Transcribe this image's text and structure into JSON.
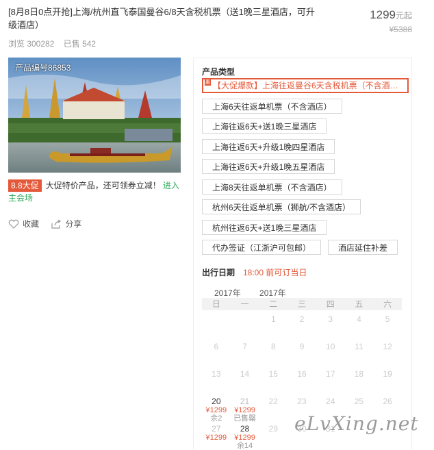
{
  "product": {
    "title": "[8月8日0点开抢]上海/杭州直飞泰国曼谷6/8天含税机票（送1晚三星酒店，可升级酒店）",
    "price": "1299",
    "price_unit": "元起",
    "original_price": "¥5388",
    "views": "浏览 300282",
    "sold": "已售 542",
    "code": "产品编号86853"
  },
  "promo": {
    "tag": "8.8大促",
    "text": "大促特价产品，还可领券立减！",
    "link": "进入主会场"
  },
  "actions": {
    "favorite": "收藏",
    "share": "分享"
  },
  "panel": {
    "type_title": "产品类型",
    "options": [
      "【大促爆款】上海往返曼谷6天含税机票（不含酒…",
      "上海6天往返单机票（不含酒店）",
      "上海往返6天+送1晚三星酒店",
      "上海往返6天+升级1晚四星酒店",
      "上海往返6天+升级1晚五星酒店",
      "上海8天往返单机票（不含酒店）",
      "杭州6天往返单机票（狮航/不含酒店）",
      "杭州往返6天+送1晚三星酒店",
      "代办签证（江浙沪可包邮）",
      "酒店延住补差"
    ],
    "selected_badge": "惠",
    "date_title": "出行日期",
    "date_note": "18:00 前可订当日"
  },
  "calendar": {
    "months": [
      "2017年",
      "2017年"
    ],
    "weekdays": [
      "日",
      "一",
      "二",
      "三",
      "四",
      "五",
      "六"
    ],
    "rows": [
      [
        {
          "d": ""
        },
        {
          "d": ""
        },
        {
          "d": "1"
        },
        {
          "d": "2"
        },
        {
          "d": "3"
        },
        {
          "d": "4"
        },
        {
          "d": "5"
        }
      ],
      [
        {
          "d": "6"
        },
        {
          "d": "7"
        },
        {
          "d": "8"
        },
        {
          "d": "9"
        },
        {
          "d": "10"
        },
        {
          "d": "11"
        },
        {
          "d": "12"
        }
      ],
      [
        {
          "d": "13"
        },
        {
          "d": "14"
        },
        {
          "d": "15"
        },
        {
          "d": "16"
        },
        {
          "d": "17"
        },
        {
          "d": "18"
        },
        {
          "d": "19"
        }
      ],
      [
        {
          "d": "20",
          "p": "¥1299",
          "r": "余2",
          "on": true
        },
        {
          "d": "21",
          "p": "¥1299",
          "r": "已售罄",
          "muted": true
        },
        {
          "d": "22"
        },
        {
          "d": "23"
        },
        {
          "d": "24"
        },
        {
          "d": "25"
        },
        {
          "d": "26"
        }
      ],
      [
        {
          "d": "27",
          "p": "¥1299",
          "r": "",
          "muted": true
        },
        {
          "d": "28",
          "p": "¥1299",
          "r": "余14",
          "on": true
        },
        {
          "d": "29"
        },
        {
          "d": "30"
        },
        {
          "d": "31"
        },
        {
          "d": ""
        },
        {
          "d": ""
        }
      ]
    ]
  },
  "watermark": "eLvXing.net",
  "colors": {
    "accent": "#e4593a",
    "link": "#2eaa5b"
  }
}
